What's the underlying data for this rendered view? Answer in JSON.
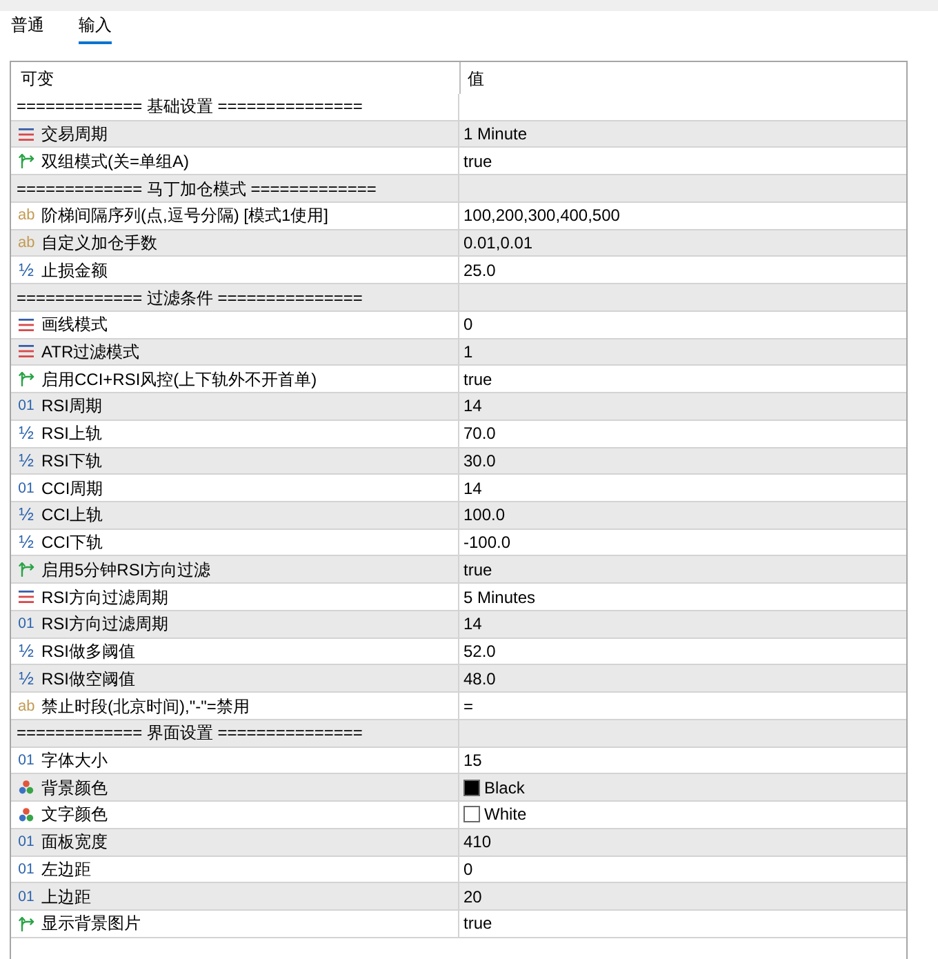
{
  "tabs": [
    {
      "label": "普通",
      "selected": false
    },
    {
      "label": "输入",
      "selected": true
    }
  ],
  "table": {
    "columns": [
      "可变",
      "值"
    ],
    "rows": [
      {
        "kind": "separator",
        "label": "============= 基础设置 ==============="
      },
      {
        "kind": "enum",
        "label": "交易周期",
        "value": "1 Minute"
      },
      {
        "kind": "bool",
        "label": "双组模式(关=单组A)",
        "value": "true"
      },
      {
        "kind": "separator",
        "label": "============= 马丁加仓模式 ============="
      },
      {
        "kind": "string",
        "type_glyph": "ab",
        "label": "阶梯间隔序列(点,逗号分隔) [模式1使用]",
        "value": "100,200,300,400,500"
      },
      {
        "kind": "string",
        "type_glyph": "ab",
        "label": "自定义加仓手数",
        "value": "0.01,0.01"
      },
      {
        "kind": "double",
        "type_glyph": "½",
        "label": "止损金额",
        "value": "25.0"
      },
      {
        "kind": "separator",
        "label": "============= 过滤条件 ==============="
      },
      {
        "kind": "enum",
        "label": "画线模式",
        "value": "0"
      },
      {
        "kind": "enum",
        "label": "ATR过滤模式",
        "value": "1"
      },
      {
        "kind": "bool",
        "label": "启用CCI+RSI风控(上下轨外不开首单)",
        "value": "true"
      },
      {
        "kind": "int",
        "type_glyph": "01",
        "label": "RSI周期",
        "value": "14"
      },
      {
        "kind": "double",
        "type_glyph": "½",
        "label": "RSI上轨",
        "value": "70.0"
      },
      {
        "kind": "double",
        "type_glyph": "½",
        "label": "RSI下轨",
        "value": "30.0"
      },
      {
        "kind": "int",
        "type_glyph": "01",
        "label": "CCI周期",
        "value": "14"
      },
      {
        "kind": "double",
        "type_glyph": "½",
        "label": "CCI上轨",
        "value": "100.0"
      },
      {
        "kind": "double",
        "type_glyph": "½",
        "label": "CCI下轨",
        "value": "-100.0"
      },
      {
        "kind": "bool",
        "label": "启用5分钟RSI方向过滤",
        "value": "true"
      },
      {
        "kind": "enum",
        "label": "RSI方向过滤周期",
        "value": "5 Minutes"
      },
      {
        "kind": "int",
        "type_glyph": "01",
        "label": "RSI方向过滤周期",
        "value": "14"
      },
      {
        "kind": "double",
        "type_glyph": "½",
        "label": "RSI做多阈值",
        "value": "52.0"
      },
      {
        "kind": "double",
        "type_glyph": "½",
        "label": "RSI做空阈值",
        "value": "48.0"
      },
      {
        "kind": "string",
        "type_glyph": "ab",
        "label": "禁止时段(北京时间),\"-\"=禁用",
        "value": "="
      },
      {
        "kind": "separator",
        "label": "============= 界面设置 ==============="
      },
      {
        "kind": "int",
        "type_glyph": "01",
        "label": "字体大小",
        "value": "15"
      },
      {
        "kind": "color",
        "label": "背景颜色",
        "value": "Black",
        "color": "#000000"
      },
      {
        "kind": "color",
        "label": "文字颜色",
        "value": "White",
        "color": "#ffffff"
      },
      {
        "kind": "int",
        "type_glyph": "01",
        "label": "面板宽度",
        "value": "410"
      },
      {
        "kind": "int",
        "type_glyph": "01",
        "label": "左边距",
        "value": "0"
      },
      {
        "kind": "int",
        "type_glyph": "01",
        "label": "上边距",
        "value": "20"
      },
      {
        "kind": "bool",
        "label": "显示背景图片",
        "value": "true"
      }
    ]
  }
}
